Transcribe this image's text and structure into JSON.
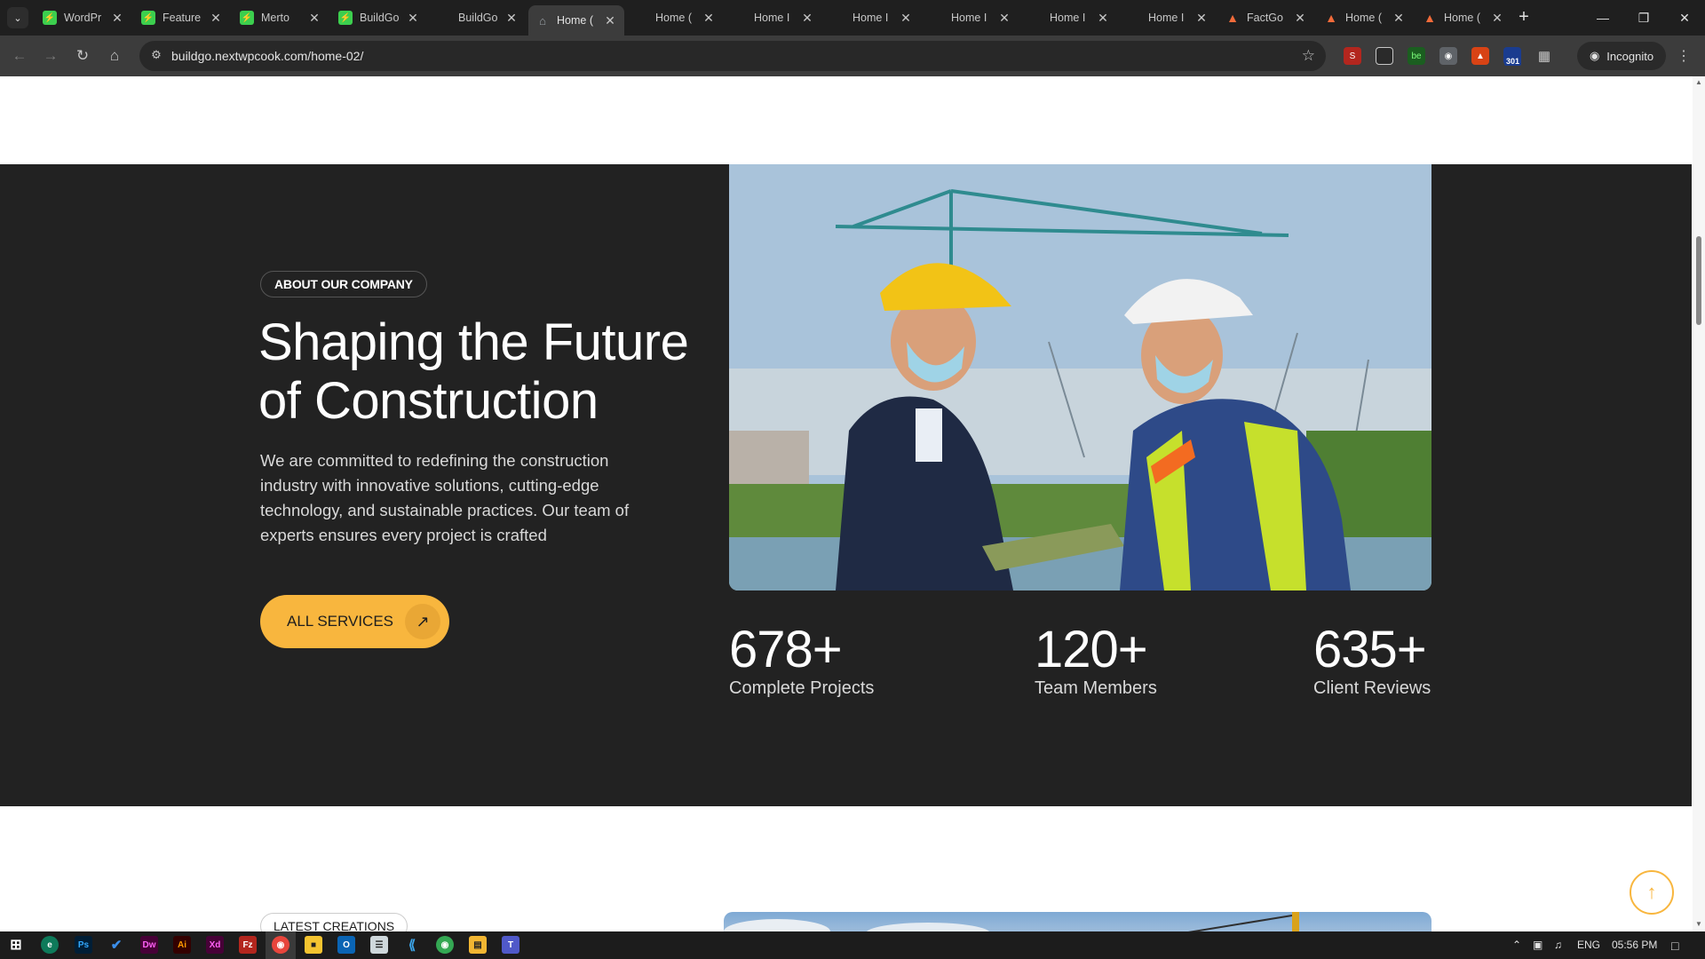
{
  "browser": {
    "tabs": [
      {
        "title": "WordPr",
        "icon": "green-app-icon",
        "active": false
      },
      {
        "title": "Feature",
        "icon": "green-app-icon",
        "active": false
      },
      {
        "title": "Merto",
        "icon": "green-app-icon",
        "active": false
      },
      {
        "title": "BuildGo",
        "icon": "green-app-icon",
        "active": false
      },
      {
        "title": "BuildGo",
        "icon": "blank",
        "active": false
      },
      {
        "title": "Home (",
        "icon": "home-icon",
        "active": true
      },
      {
        "title": "Home (",
        "icon": "blank",
        "active": false
      },
      {
        "title": "Home I",
        "icon": "blank",
        "active": false
      },
      {
        "title": "Home I",
        "icon": "blank",
        "active": false
      },
      {
        "title": "Home I",
        "icon": "blank",
        "active": false
      },
      {
        "title": "Home I",
        "icon": "blank",
        "active": false
      },
      {
        "title": "Home I",
        "icon": "blank",
        "active": false
      },
      {
        "title": "FactGo",
        "icon": "orange-logo-icon",
        "active": false
      },
      {
        "title": "Home (",
        "icon": "orange-logo-icon",
        "active": false
      },
      {
        "title": "Home (",
        "icon": "orange-logo-icon",
        "active": false
      }
    ],
    "url": "buildgo.nextwpcook.com/home-02/",
    "incognito_label": "Incognito",
    "extension_badge": "301"
  },
  "about": {
    "badge": "ABOUT OUR COMPANY",
    "headline_line1": "Shaping the Future",
    "headline_line2": "of Construction",
    "description": "We are committed to redefining the construction industry with innovative solutions, cutting-edge technology, and sustainable practices. Our team of experts ensures every project is crafted",
    "cta_label": "ALL SERVICES",
    "stats": [
      {
        "value": "678+",
        "label": "Complete Projects"
      },
      {
        "value": "120+",
        "label": "Team Members"
      },
      {
        "value": "635+",
        "label": "Client Reviews"
      }
    ]
  },
  "latest": {
    "badge": "LATEST CREATIONS"
  },
  "taskbar": {
    "language": "ENG",
    "time": "05:56 PM"
  },
  "colors": {
    "accent": "#f8b63e",
    "dark_section": "#222222",
    "chrome_dark": "#1f1f1f"
  }
}
